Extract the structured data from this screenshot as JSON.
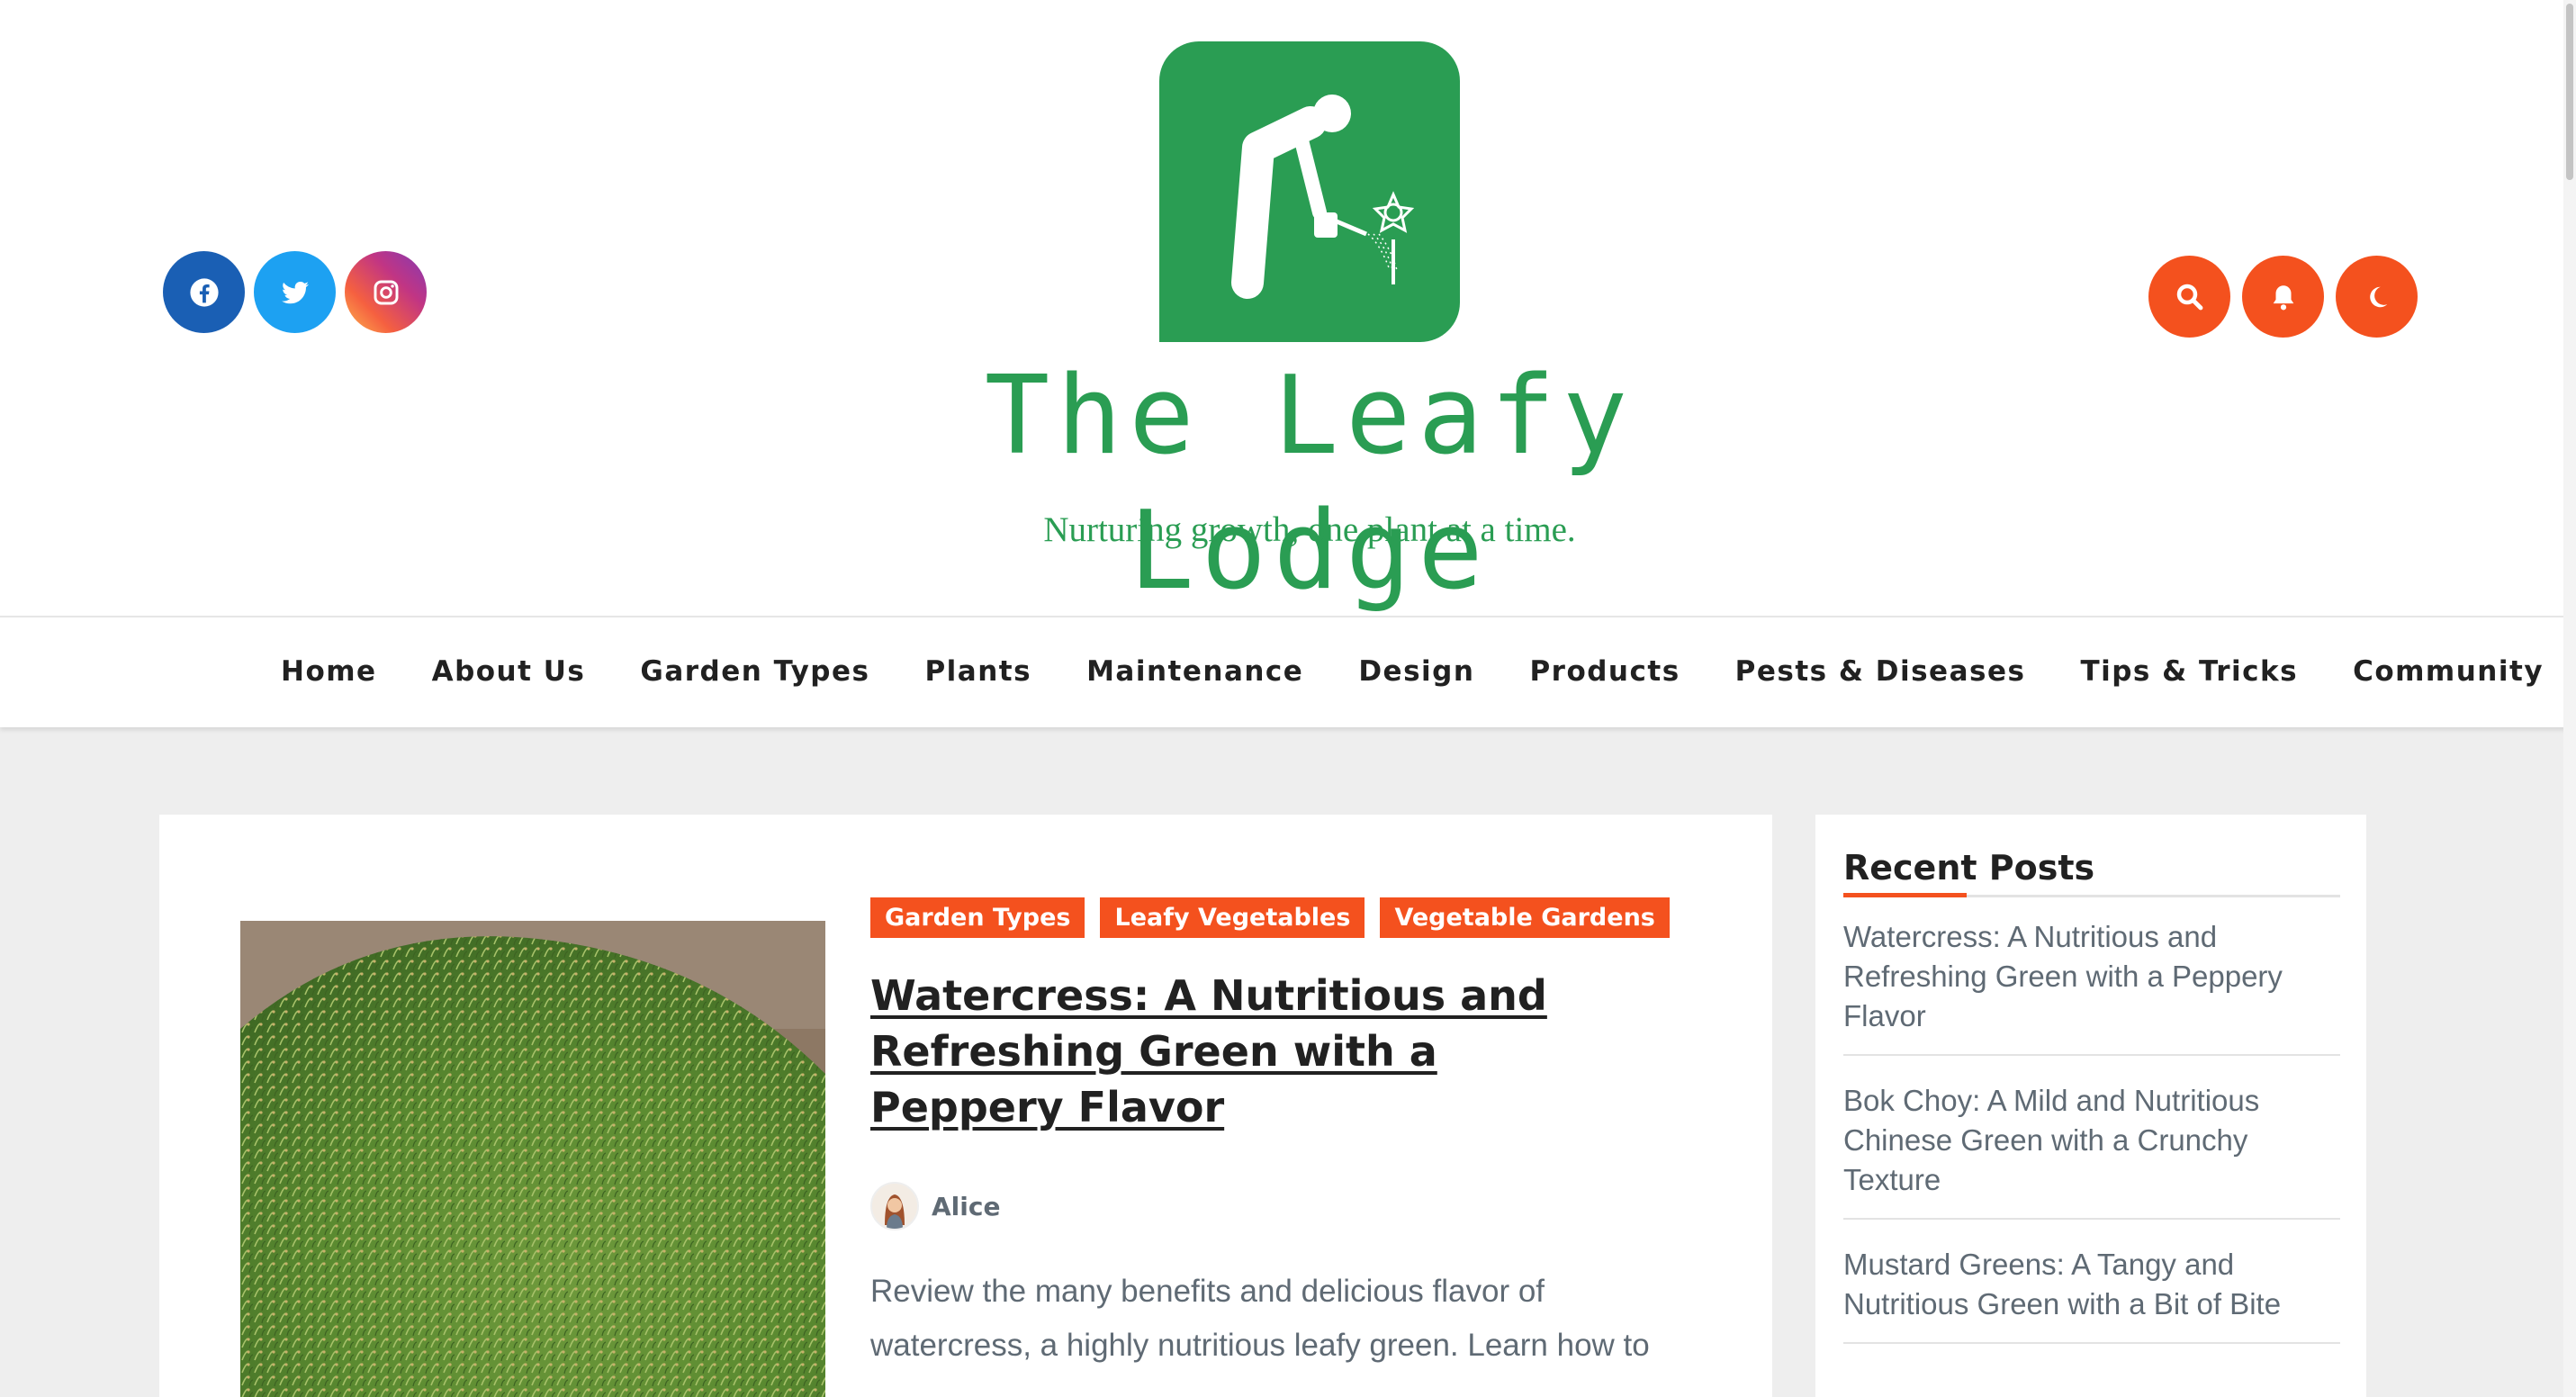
{
  "site": {
    "title": "The Leafy Lodge",
    "tagline": "Nurturing growth, one plant at a time.",
    "brand_color": "#2a9d53",
    "accent_color": "#f4511e"
  },
  "social": [
    {
      "name": "facebook-icon",
      "color": "#1a5fb4"
    },
    {
      "name": "twitter-icon",
      "color": "#1da1f2"
    },
    {
      "name": "instagram-icon",
      "color": "#c13584"
    }
  ],
  "header_actions": [
    "search-icon",
    "bell-icon",
    "moon-icon"
  ],
  "nav": {
    "items": [
      "Home",
      "About Us",
      "Garden Types",
      "Plants",
      "Maintenance",
      "Design",
      "Products",
      "Pests & Diseases",
      "Tips & Tricks",
      "Community"
    ]
  },
  "post": {
    "categories": [
      "Garden Types",
      "Leafy Vegetables",
      "Vegetable Gardens"
    ],
    "title": "Watercress: A Nutritious and Refreshing Green with a Peppery Flavor",
    "author": "Alice",
    "excerpt": "Review the many benefits and delicious flavor of watercress, a highly nutritious leafy green. Learn how to"
  },
  "sidebar": {
    "heading": "Recent Posts",
    "items": [
      "Watercress: A Nutritious and Refreshing Green with a Peppery Flavor",
      "Bok Choy: A Mild and Nutritious Chinese Green with a Crunchy Texture",
      "Mustard Greens: A Tangy and Nutritious Green with a Bit of Bite"
    ]
  }
}
